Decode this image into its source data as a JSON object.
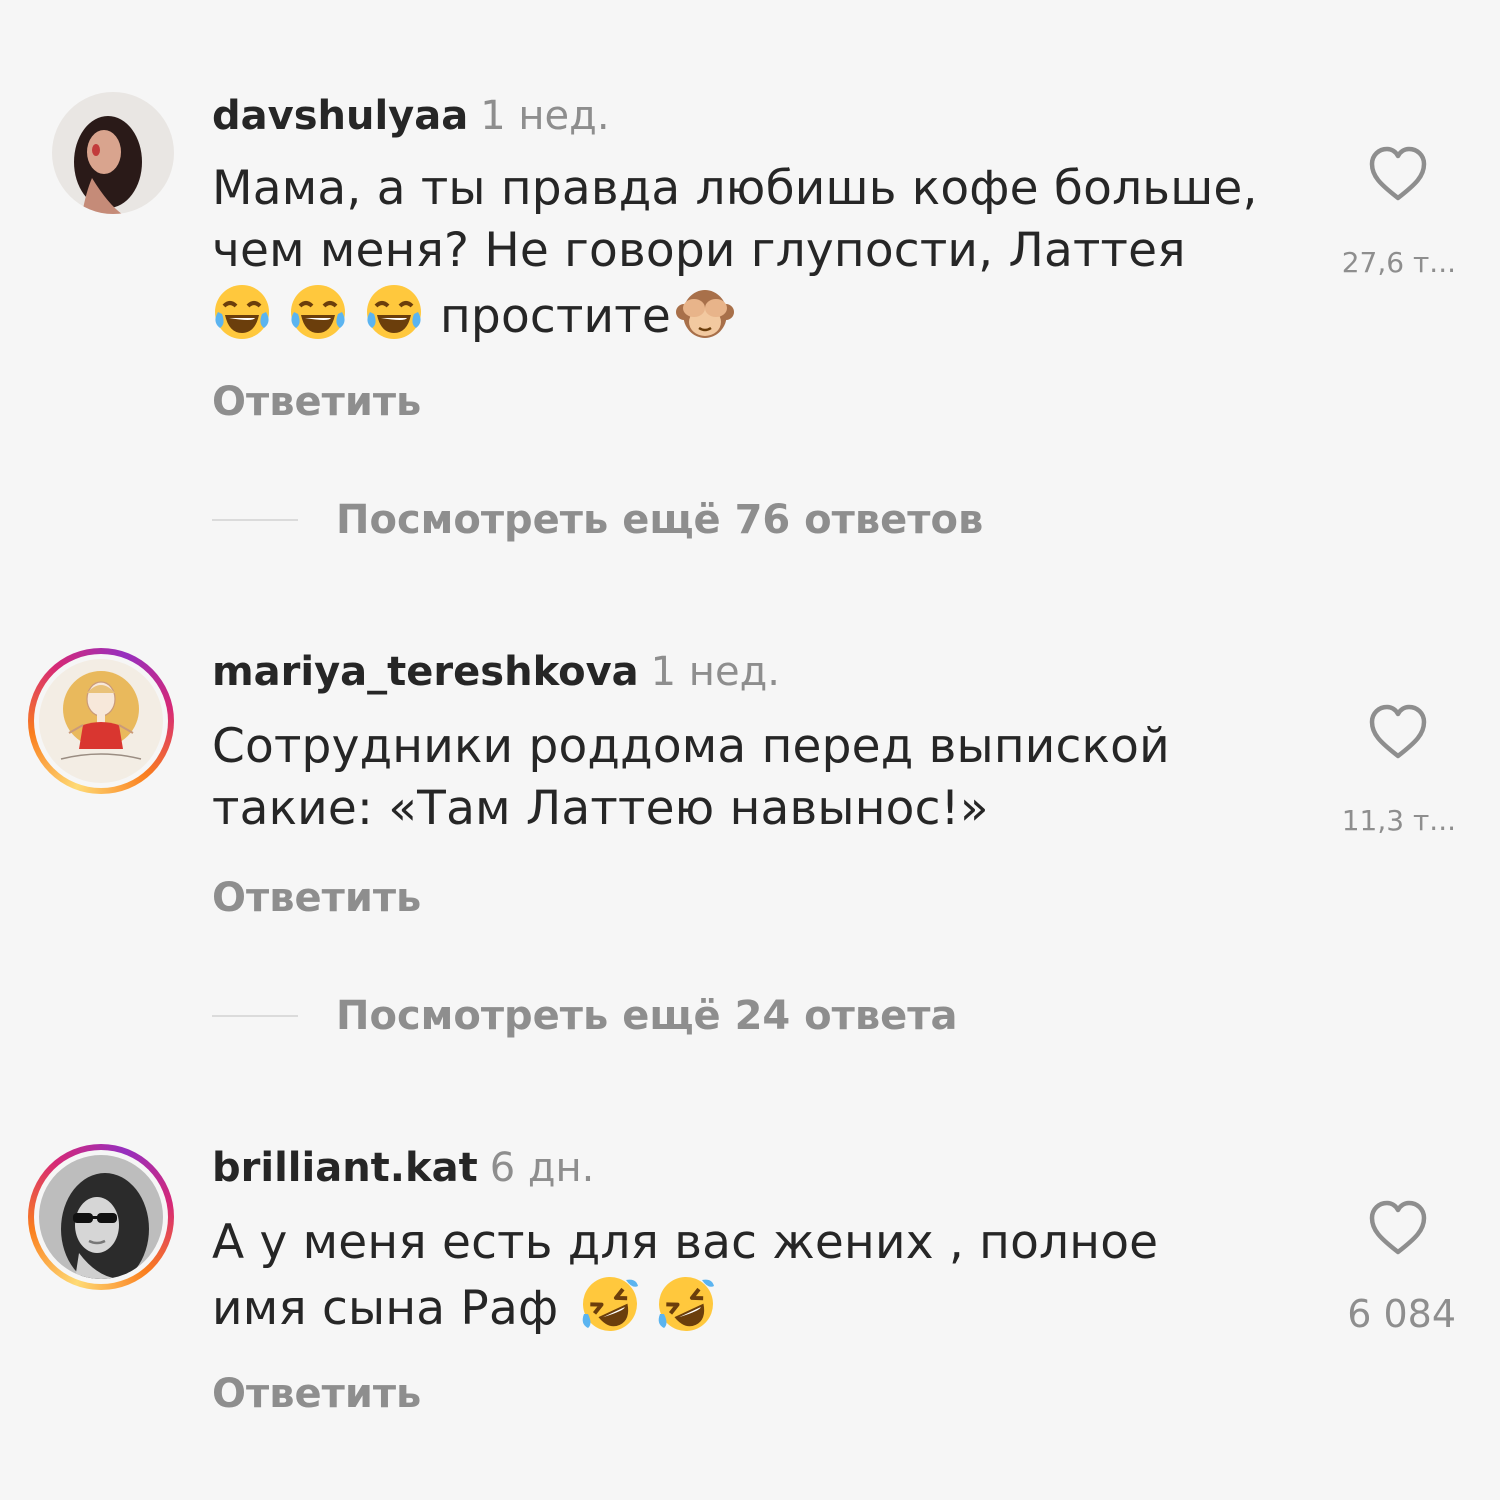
{
  "comments": [
    {
      "username": "davshulyaa",
      "time": "1 нед.",
      "text_line1": "Мама, а ты правда любишь кофе больше,",
      "text_line2": "чем меня? Не говори глупости, Латтея",
      "text_line3": "простите",
      "emojis": [
        "face-with-tears-of-joy",
        "face-with-tears-of-joy",
        "face-with-tears-of-joy",
        "see-no-evil-monkey"
      ],
      "likes": "27,6 т...",
      "reply_label": "Ответить",
      "view_more": "Посмотреть ещё 76 ответов"
    },
    {
      "username": "mariya_tereshkova",
      "time": "1 нед.",
      "text_line1": "Сотрудники роддома перед выпиской",
      "text_line2": "такие: «Там Латтею навынос!»",
      "likes": "11,3 т...",
      "reply_label": "Ответить",
      "view_more": "Посмотреть ещё 24 ответа"
    },
    {
      "username": "brilliant.kat",
      "time": "6 дн.",
      "text_line1": "А у меня есть для вас жених , полное",
      "text_line2": "имя сына Раф",
      "emojis": [
        "rolling-on-the-floor-laughing",
        "rolling-on-the-floor-laughing"
      ],
      "likes": "6 084",
      "reply_label": "Ответить"
    }
  ],
  "colors": {
    "background": "#f6f6f6",
    "text": "#262626",
    "secondary": "#8e8e8e"
  }
}
